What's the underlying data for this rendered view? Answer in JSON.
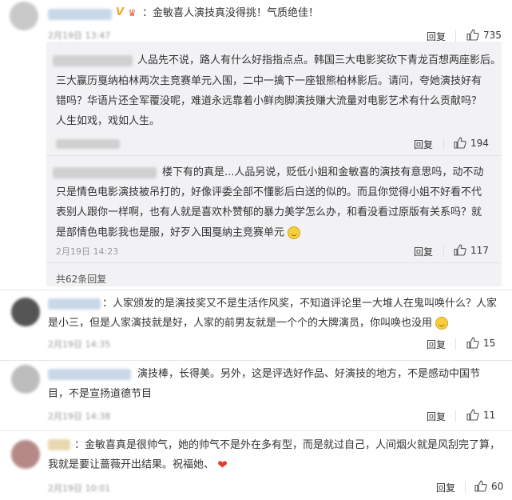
{
  "comments": {
    "c1": {
      "text": "：金敏喜人演技真没得挑！气质绝佳！",
      "date": "2月19日 13:47",
      "reply": "回复",
      "likes": "735"
    },
    "sub1": {
      "lines": [
        "人品先不说，路人有什么好指指点点。韩国三大电影奖砍下青龙百想两座影后。",
        "三大赢历戛纳柏林两次主竞赛单元入围，二中一擒下一座银熊柏林影后。请问，夸她演技好有",
        "错吗？华语片还全军覆没呢，难道永远靠着小鲜肉脚演技赚大流量对电影艺术有什么贡献吗？",
        "人生如戏，戏如人生。"
      ],
      "reply": "回复",
      "likes": "194"
    },
    "sub2": {
      "lines": [
        "楼下有的真是...人品另说，贬低小姐和金敏喜的演技有意思吗，动不动",
        "只是情色电影演技被吊打的，好像评委全部不懂影后白送的似的。而且你觉得小姐不好看不代",
        "表别人跟你一样啊，也有人就是喜欢朴赞郁的暴力美学怎么办，和看没看过原版有关系吗？就",
        "是部情色电影我也是服，好歹入围戛纳主竞赛单元"
      ],
      "date": "2月19日 14:23",
      "reply": "回复",
      "likes": "117"
    },
    "total_replies": "共62条回复",
    "c2": {
      "lines": [
        "：人家颁发的是演技奖又不是生活作风奖，不知道评论里一大堆人在鬼叫唤什么？人家",
        "是小三，但是人家演技就是好，人家的前男友就是一个个的大牌演员，你叫唤也没用"
      ],
      "date": "2月19日 14:35",
      "reply": "回复",
      "likes": "15"
    },
    "c3": {
      "lines": [
        "演技棒，长得美。另外，这是评选好作品、好演技的地方，不是感动中国节",
        "目，不是宣扬道德节目"
      ],
      "date": "2月19日 14:38",
      "reply": "回复",
      "likes": "11"
    },
    "c4": {
      "lines": [
        "：金敏喜真是很帅气，她的帅气不是外在多有型，而是就过自己，人间烟火就是风刮完了算，",
        "我就是要让蔷薇开出结果。祝福她、"
      ],
      "date": "2月19日 10:01",
      "reply": "回复",
      "likes": "60"
    }
  },
  "colors": {
    "heart": "#e63b28",
    "verified": "#f5a623"
  },
  "icons": [
    "thumbs-up-icon",
    "smile-emoji-icon",
    "heart-emoji-icon",
    "verified-badge-icon"
  ]
}
